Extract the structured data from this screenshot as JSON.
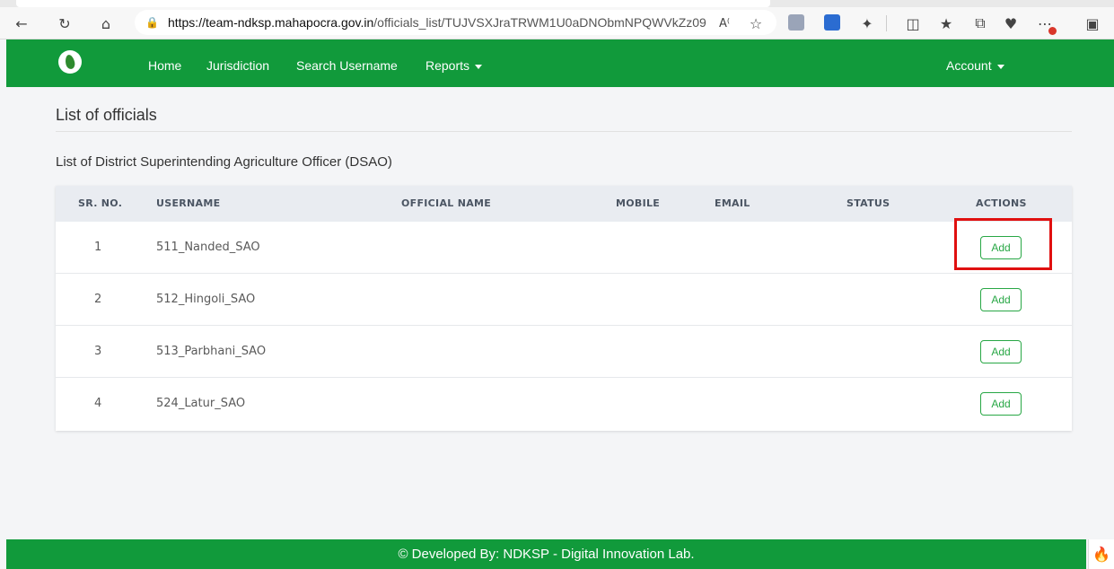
{
  "browser": {
    "url_host": "https://team-ndksp.mahapocra.gov.in",
    "url_path": "/officials_list/TUJVSXJraTRWM1U0aDNObmNPQWVkZz09"
  },
  "navbar": {
    "brand_color": "#119a3b",
    "items": [
      {
        "label": "Home"
      },
      {
        "label": "Jurisdiction"
      },
      {
        "label": "Search Username"
      },
      {
        "label": "Reports"
      }
    ],
    "account_label": "Account"
  },
  "page": {
    "title": "List of officials",
    "section_title": "List of District Superintending Agriculture Officer (DSAO)"
  },
  "table": {
    "headers": [
      "SR. NO.",
      "USERNAME",
      "OFFICIAL NAME",
      "MOBILE",
      "EMAIL",
      "STATUS",
      "ACTIONS"
    ],
    "rows": [
      {
        "sr": "1",
        "username": "511_Nanded_SAO",
        "official_name": "",
        "mobile": "",
        "email": "",
        "status": "",
        "action": "Add"
      },
      {
        "sr": "2",
        "username": "512_Hingoli_SAO",
        "official_name": "",
        "mobile": "",
        "email": "",
        "status": "",
        "action": "Add"
      },
      {
        "sr": "3",
        "username": "513_Parbhani_SAO",
        "official_name": "",
        "mobile": "",
        "email": "",
        "status": "",
        "action": "Add"
      },
      {
        "sr": "4",
        "username": "524_Latur_SAO",
        "official_name": "",
        "mobile": "",
        "email": "",
        "status": "",
        "action": "Add"
      }
    ]
  },
  "footer": {
    "text": "© Developed By: NDKSP - Digital Innovation Lab."
  }
}
